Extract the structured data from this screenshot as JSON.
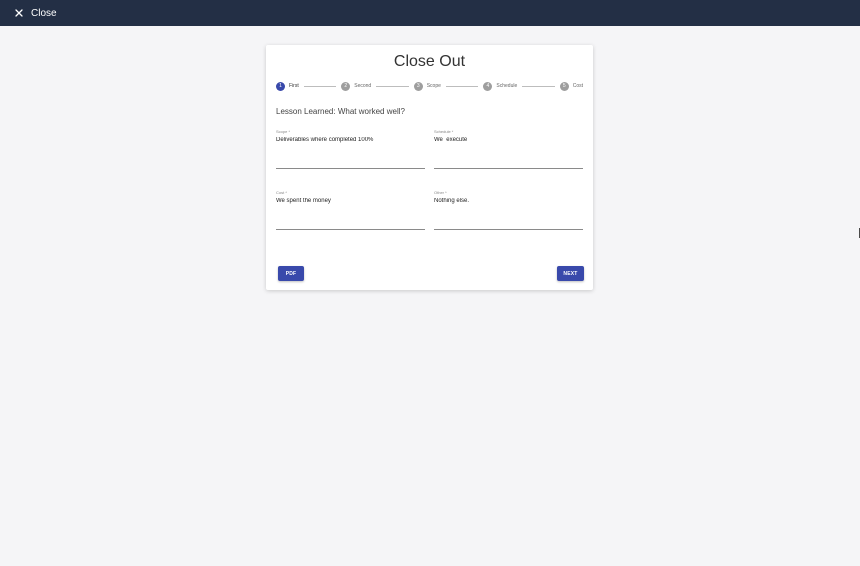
{
  "topbar": {
    "close_label": "Close",
    "close_icon": "close-icon",
    "background": "#232f45"
  },
  "card": {
    "title": "Close Out"
  },
  "stepper": {
    "steps": [
      {
        "number": "1",
        "label": "First",
        "active": true
      },
      {
        "number": "2",
        "label": "Second",
        "active": false
      },
      {
        "number": "3",
        "label": "Scope",
        "active": false
      },
      {
        "number": "4",
        "label": "Schedule",
        "active": false
      },
      {
        "number": "5",
        "label": "Cost",
        "active": false
      }
    ],
    "active_color": "#3949ab"
  },
  "section": {
    "heading": "Lesson Learned: What worked well?"
  },
  "fields": {
    "scope": {
      "label": "Scope *",
      "value": "Deliverables where completed 100%"
    },
    "schedule": {
      "label": "Schedule *",
      "value": "We  execute"
    },
    "cost": {
      "label": "Cost *",
      "value": "We spent the money"
    },
    "other": {
      "label": "Other *",
      "value": "Nothing else."
    }
  },
  "buttons": {
    "pdf_label": "PDF",
    "next_label": "NEXT",
    "color": "#3949ab"
  }
}
